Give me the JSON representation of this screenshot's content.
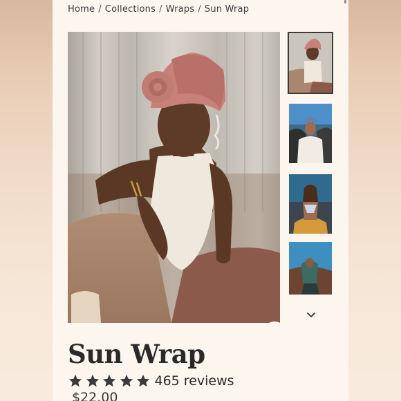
{
  "breadcrumb": {
    "items": [
      "Home",
      "Collections",
      "Wraps",
      "Sun Wrap"
    ],
    "separator": "/"
  },
  "product": {
    "title": "Sun Wrap",
    "rating": 5,
    "reviews_label": "465 reviews",
    "price": "$22.00"
  },
  "gallery": {
    "thumbnail_count": 4,
    "active_thumbnail": 0,
    "icons": {
      "zoom": "search-icon",
      "next": "chevron-down-icon",
      "rating": "star-icon"
    }
  },
  "colors": {
    "page_background": "#fdf6ee",
    "text": "#2a2a2a",
    "wrap_rose": "#c8817a",
    "active_border": "#3a3a3a"
  }
}
